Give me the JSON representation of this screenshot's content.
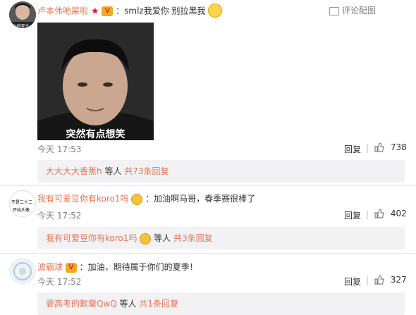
{
  "comments": [
    {
      "user": "卢本伟吔屎啦",
      "text": "：smlz我爱你 别拉黑我",
      "time": "今天 17:53",
      "reply_label": "回复",
      "likes": "738",
      "report": "评论配图",
      "image_caption": "突然有点想笑",
      "avatar_caption": "心碎那头",
      "replies_summary": {
        "user": "大大大大香蕉h",
        "mid": "等人",
        "link": "共73条回复"
      }
    },
    {
      "user": "我有可爱豆你有koro1吗",
      "text": "：加油啊马哥，春季赛很棒了",
      "time": "今天 17:52",
      "reply_label": "回复",
      "likes": "402",
      "avatar_line1": "不是二十二",
      "avatar_line2": "开始头像",
      "replies_summary": {
        "user": "我有可爱豆你有koro1吗",
        "mid": "等人",
        "link": "共3条回复"
      }
    },
    {
      "user": "波霸球",
      "text": "：加油，期待属于你们的夏季！",
      "time": "今天 17:52",
      "reply_label": "回复",
      "likes": "327",
      "replies_summary": {
        "user": "要高考的歎棄QwQ",
        "mid": "等人",
        "link": "共1条回复"
      }
    }
  ]
}
